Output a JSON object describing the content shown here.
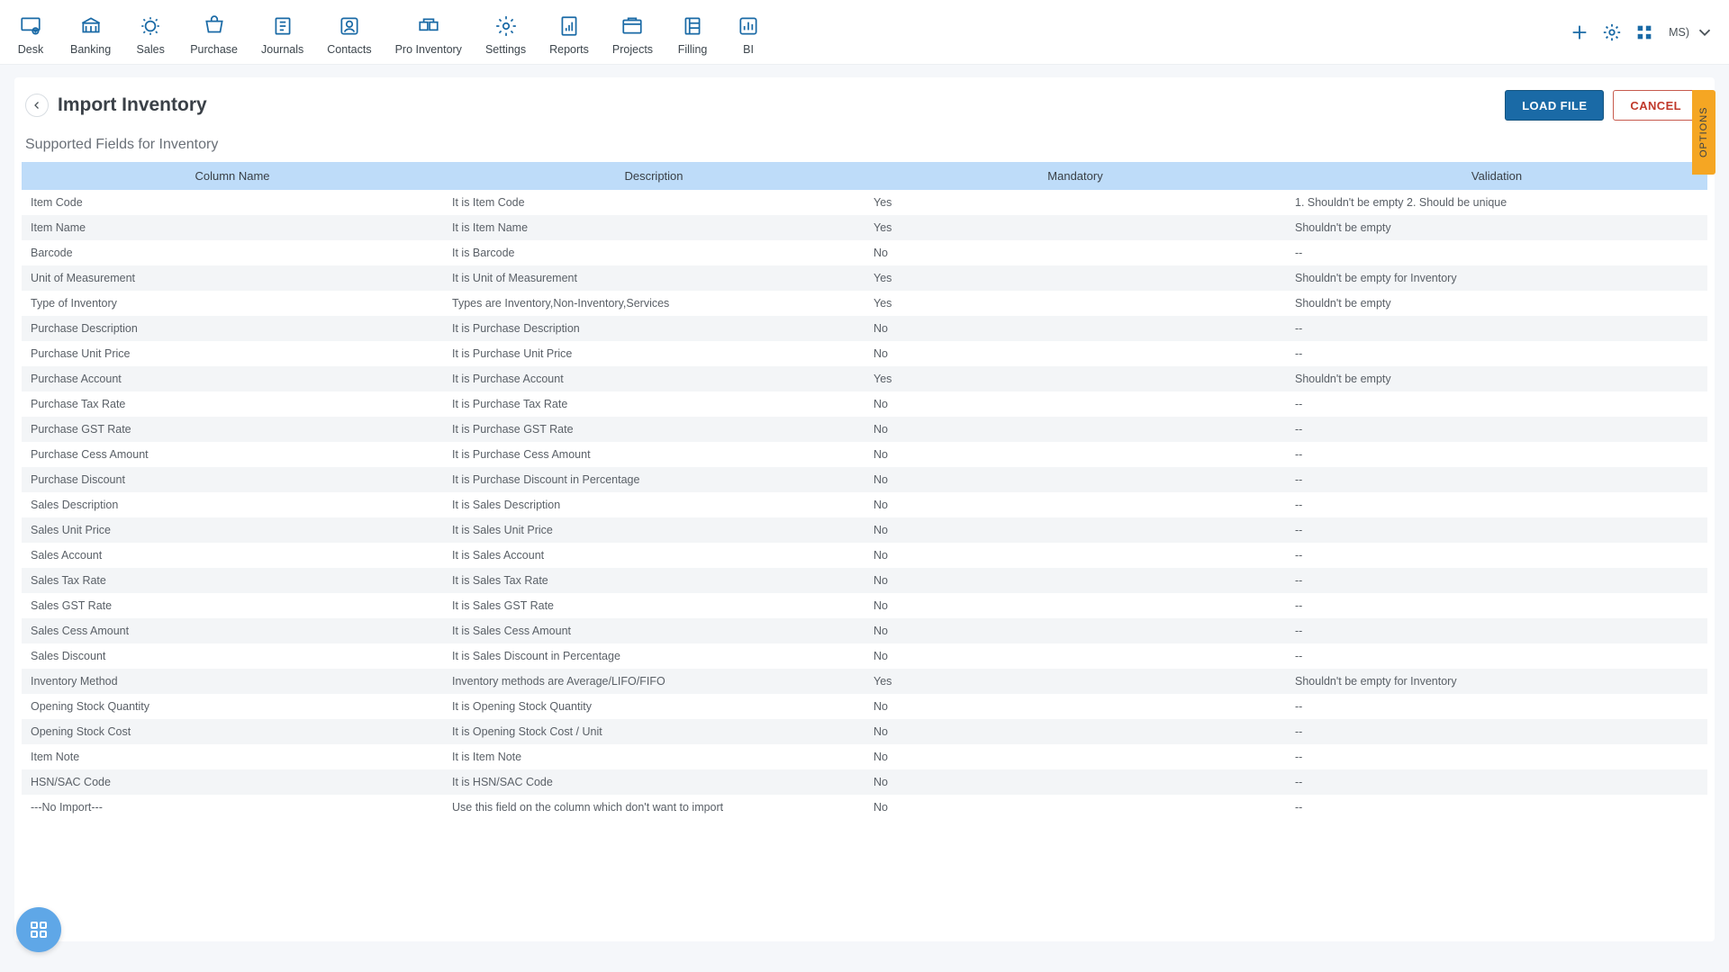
{
  "nav": {
    "items": [
      {
        "label": "Desk"
      },
      {
        "label": "Banking"
      },
      {
        "label": "Sales"
      },
      {
        "label": "Purchase"
      },
      {
        "label": "Journals"
      },
      {
        "label": "Contacts"
      },
      {
        "label": "Pro Inventory"
      },
      {
        "label": "Settings"
      },
      {
        "label": "Reports"
      },
      {
        "label": "Projects"
      },
      {
        "label": "Filling"
      },
      {
        "label": "BI"
      }
    ],
    "user": "MS)"
  },
  "page": {
    "title": "Import Inventory",
    "load_file_label": "LOAD FILE",
    "cancel_label": "CANCEL",
    "subhead": "Supported Fields for Inventory",
    "options_label": "OPTIONS"
  },
  "table": {
    "headers": {
      "col1": "Column Name",
      "col2": "Description",
      "col3": "Mandatory",
      "col4": "Validation"
    },
    "rows": [
      {
        "c1": "Item Code",
        "c2": "It is Item Code",
        "c3": "Yes",
        "c4": "1. Shouldn't be empty 2. Should be unique"
      },
      {
        "c1": "Item Name",
        "c2": "It is Item Name",
        "c3": "Yes",
        "c4": "Shouldn't be empty"
      },
      {
        "c1": "Barcode",
        "c2": "It is Barcode",
        "c3": "No",
        "c4": "--"
      },
      {
        "c1": "Unit of Measurement",
        "c2": "It is Unit of Measurement",
        "c3": "Yes",
        "c4": "Shouldn't be empty for Inventory"
      },
      {
        "c1": "Type of Inventory",
        "c2": "Types are Inventory,Non-Inventory,Services",
        "c3": "Yes",
        "c4": "Shouldn't be empty"
      },
      {
        "c1": "Purchase Description",
        "c2": "It is Purchase Description",
        "c3": "No",
        "c4": "--"
      },
      {
        "c1": "Purchase Unit Price",
        "c2": "It is Purchase Unit Price",
        "c3": "No",
        "c4": "--"
      },
      {
        "c1": "Purchase Account",
        "c2": "It is Purchase Account",
        "c3": "Yes",
        "c4": "Shouldn't be empty"
      },
      {
        "c1": "Purchase Tax Rate",
        "c2": "It is Purchase Tax Rate",
        "c3": "No",
        "c4": "--"
      },
      {
        "c1": "Purchase GST Rate",
        "c2": "It is Purchase GST Rate",
        "c3": "No",
        "c4": "--"
      },
      {
        "c1": "Purchase Cess Amount",
        "c2": "It is Purchase Cess Amount",
        "c3": "No",
        "c4": "--"
      },
      {
        "c1": "Purchase Discount",
        "c2": "It is Purchase Discount in Percentage",
        "c3": "No",
        "c4": "--"
      },
      {
        "c1": "Sales Description",
        "c2": "It is Sales Description",
        "c3": "No",
        "c4": "--"
      },
      {
        "c1": "Sales Unit Price",
        "c2": "It is Sales Unit Price",
        "c3": "No",
        "c4": "--"
      },
      {
        "c1": "Sales Account",
        "c2": "It is Sales Account",
        "c3": "No",
        "c4": "--"
      },
      {
        "c1": "Sales Tax Rate",
        "c2": "It is Sales Tax Rate",
        "c3": "No",
        "c4": "--"
      },
      {
        "c1": "Sales GST Rate",
        "c2": "It is Sales GST Rate",
        "c3": "No",
        "c4": "--"
      },
      {
        "c1": "Sales Cess Amount",
        "c2": "It is Sales Cess Amount",
        "c3": "No",
        "c4": "--"
      },
      {
        "c1": "Sales Discount",
        "c2": "It is Sales Discount in Percentage",
        "c3": "No",
        "c4": "--"
      },
      {
        "c1": "Inventory Method",
        "c2": "Inventory methods are Average/LIFO/FIFO",
        "c3": "Yes",
        "c4": "Shouldn't be empty for Inventory"
      },
      {
        "c1": "Opening Stock Quantity",
        "c2": "It is Opening Stock Quantity",
        "c3": "No",
        "c4": "--"
      },
      {
        "c1": "Opening Stock Cost",
        "c2": "It is Opening Stock Cost / Unit",
        "c3": "No",
        "c4": "--"
      },
      {
        "c1": "Item Note",
        "c2": "It is Item Note",
        "c3": "No",
        "c4": "--"
      },
      {
        "c1": "HSN/SAC Code",
        "c2": "It is HSN/SAC Code",
        "c3": "No",
        "c4": "--"
      },
      {
        "c1": "---No Import---",
        "c2": "Use this field on the column which don't want to import",
        "c3": "No",
        "c4": "--"
      }
    ]
  }
}
